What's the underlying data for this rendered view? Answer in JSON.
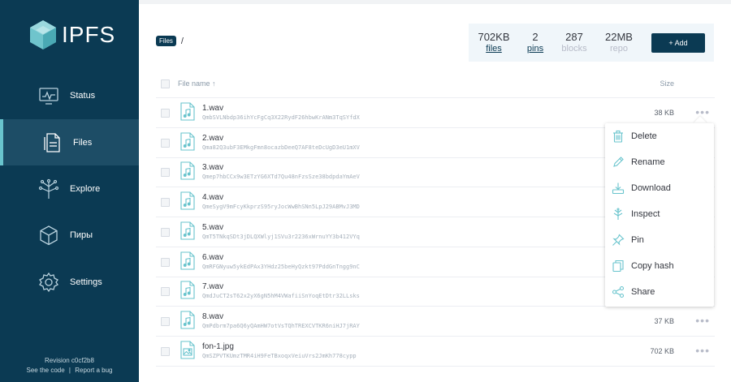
{
  "app": {
    "logo_text": "IPFS"
  },
  "sidebar": {
    "items": [
      {
        "label": "Status",
        "icon": "status-monitor-icon",
        "active": false
      },
      {
        "label": "Files",
        "icon": "files-icon",
        "active": true
      },
      {
        "label": "Explore",
        "icon": "explore-tree-icon",
        "active": false
      },
      {
        "label": "Пиры",
        "icon": "peers-cube-icon",
        "active": false
      },
      {
        "label": "Settings",
        "icon": "gear-icon",
        "active": false
      }
    ],
    "footer": {
      "revision": "Revision c0cf2b8",
      "see_code": "See the code",
      "separator": "|",
      "report_bug": "Report a bug"
    }
  },
  "breadcrumb": {
    "root": "Files",
    "separator": "/"
  },
  "stats": {
    "files": {
      "value": "702KB",
      "label": "files"
    },
    "pins": {
      "value": "2",
      "label": "pins"
    },
    "blocks": {
      "value": "287",
      "label": "blocks"
    },
    "repo": {
      "value": "22MB",
      "label": "repo"
    }
  },
  "add_button": "+ Add",
  "list_header": {
    "name": "File name ↑",
    "size": "Size"
  },
  "files": [
    {
      "name": "1.wav",
      "hash": "QmbSVLNbdp36ihYcFgCq3X22RydF26hbwKrANm3TqSYfdX",
      "size": "38 KB",
      "type": "audio"
    },
    {
      "name": "2.wav",
      "hash": "Qma82Q3ubF3EMkgFmn8ocazbDeeQ7AF8teDcUgD3eU1mXV",
      "size": "",
      "type": "audio"
    },
    {
      "name": "3.wav",
      "hash": "Qmep7hbCCx9w3ETzYG6XTd7Qu48nFzsSze38bdpdaYmAeV",
      "size": "",
      "type": "audio"
    },
    {
      "name": "4.wav",
      "hash": "QmeSygV9mFcyKkprzS95ryJocWwBhSNn5LpJ29ABMvJ3MD",
      "size": "",
      "type": "audio"
    },
    {
      "name": "5.wav",
      "hash": "QmT5TNkqSDt3jDLQXWlyj1SVu3r2236xWrnuYY3b412VYq",
      "size": "",
      "type": "audio"
    },
    {
      "name": "6.wav",
      "hash": "QmRFGNyuw5ykEdPAx3YHdz25beHyQzkt97PddGnTngg9nC",
      "size": "",
      "type": "audio"
    },
    {
      "name": "7.wav",
      "hash": "QmdJuCT2sT62x2yX6gN5hM4VWafiiSnYoqEtDtr32LLsks",
      "size": "",
      "type": "audio"
    },
    {
      "name": "8.wav",
      "hash": "QmPdbrm7pa6Q6yQAmHW7otVsTQhTREXCVTKR6niHJ7jRAY",
      "size": "37 KB",
      "type": "audio"
    },
    {
      "name": "fon-1.jpg",
      "hash": "QmSZPVTKUmzTMR4iH9FeTBxoqxVeiuVrs2JmKh778cypp",
      "size": "702 KB",
      "type": "image"
    }
  ],
  "context_menu": {
    "items": [
      {
        "label": "Delete",
        "icon": "trash-icon"
      },
      {
        "label": "Rename",
        "icon": "pencil-icon"
      },
      {
        "label": "Download",
        "icon": "download-icon"
      },
      {
        "label": "Inspect",
        "icon": "inspect-icon"
      },
      {
        "label": "Pin",
        "icon": "pin-icon"
      },
      {
        "label": "Copy hash",
        "icon": "copy-icon"
      },
      {
        "label": "Share",
        "icon": "share-icon"
      }
    ]
  },
  "colors": {
    "sidebar_bg": "#0b3a53",
    "sidebar_active": "#1d4d66",
    "accent_teal": "#69c4cd",
    "stats_bg": "#f0f6fa"
  }
}
